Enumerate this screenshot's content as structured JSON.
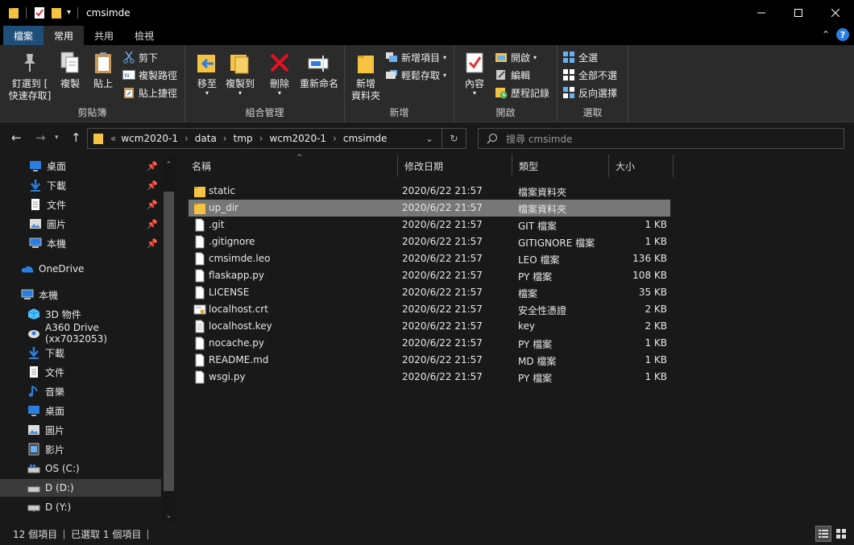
{
  "window": {
    "title": "cmsimde"
  },
  "ribbon_tabs": [
    {
      "label": "檔案"
    },
    {
      "label": "常用"
    },
    {
      "label": "共用"
    },
    {
      "label": "檢視"
    }
  ],
  "clipboard": {
    "pin_label_1": "釘選到 [",
    "pin_label_2": "快速存取]",
    "copy_label": "複製",
    "paste_label": "貼上",
    "cut_label": "剪下",
    "copy_path_label": "複製路徑",
    "paste_shortcut_label": "貼上捷徑",
    "group_label": "剪貼簿"
  },
  "organize": {
    "move_label": "移至",
    "copyto_label": "複製到",
    "delete_label": "刪除",
    "rename_label": "重新命名",
    "group_label": "組合管理"
  },
  "new_group": {
    "new_folder_label_1": "新增",
    "new_folder_label_2": "資料夾",
    "new_item_label": "新增項目",
    "easy_access_label": "輕鬆存取",
    "group_label": "新增"
  },
  "open_group": {
    "properties_label": "內容",
    "open_label": "開啟",
    "edit_label": "編輯",
    "history_label": "歷程記錄",
    "group_label": "開啟"
  },
  "select_group": {
    "select_all_label": "全選",
    "select_none_label": "全部不選",
    "invert_label": "反向選擇",
    "group_label": "選取"
  },
  "address": {
    "overflow": "«",
    "crumbs": [
      "wcm2020-1",
      "data",
      "tmp",
      "wcm2020-1",
      "cmsimde"
    ]
  },
  "search": {
    "placeholder": "搜尋 cmsimde"
  },
  "sidebar": {
    "items": [
      {
        "label": "桌面",
        "icon": "desktop-icon",
        "pinned": true
      },
      {
        "label": "下載",
        "icon": "download-icon",
        "pinned": true
      },
      {
        "label": "文件",
        "icon": "document-icon",
        "pinned": true
      },
      {
        "label": "圖片",
        "icon": "pictures-icon",
        "pinned": true
      },
      {
        "label": "本機",
        "icon": "computer-icon",
        "pinned": true
      },
      {
        "label": "OneDrive",
        "icon": "onedrive-icon"
      },
      {
        "label": "本機",
        "icon": "computer-icon"
      },
      {
        "label": "3D 物件",
        "icon": "3d-objects-icon"
      },
      {
        "label": "A360 Drive (xx7032053)",
        "icon": "a360-drive-icon"
      },
      {
        "label": "下載",
        "icon": "download-icon"
      },
      {
        "label": "文件",
        "icon": "document-icon"
      },
      {
        "label": "音樂",
        "icon": "music-icon"
      },
      {
        "label": "桌面",
        "icon": "desktop-icon"
      },
      {
        "label": "圖片",
        "icon": "pictures-icon"
      },
      {
        "label": "影片",
        "icon": "videos-icon"
      },
      {
        "label": "OS (C:)",
        "icon": "drive-icon"
      },
      {
        "label": "D (D:)",
        "icon": "drive-icon",
        "selected": true
      },
      {
        "label": "D (Y:)",
        "icon": "network-drive-icon"
      }
    ]
  },
  "columns": {
    "name": "名稱",
    "date": "修改日期",
    "type": "類型",
    "size": "大小"
  },
  "files": [
    {
      "name": "static",
      "date": "2020/6/22 21:57",
      "type": "檔案資料夾",
      "size": "",
      "icon": "folder-icon"
    },
    {
      "name": "up_dir",
      "date": "2020/6/22 21:57",
      "type": "檔案資料夾",
      "size": "",
      "icon": "folder-icon",
      "selected": true
    },
    {
      "name": ".git",
      "date": "2020/6/22 21:57",
      "type": "GIT 檔案",
      "size": "1 KB",
      "icon": "file-icon"
    },
    {
      "name": ".gitignore",
      "date": "2020/6/22 21:57",
      "type": "GITIGNORE 檔案",
      "size": "1 KB",
      "icon": "file-icon"
    },
    {
      "name": "cmsimde.leo",
      "date": "2020/6/22 21:57",
      "type": "LEO 檔案",
      "size": "136 KB",
      "icon": "file-icon"
    },
    {
      "name": "flaskapp.py",
      "date": "2020/6/22 21:57",
      "type": "PY 檔案",
      "size": "108 KB",
      "icon": "file-icon"
    },
    {
      "name": "LICENSE",
      "date": "2020/6/22 21:57",
      "type": "檔案",
      "size": "35 KB",
      "icon": "file-icon"
    },
    {
      "name": "localhost.crt",
      "date": "2020/6/22 21:57",
      "type": "安全性憑證",
      "size": "2 KB",
      "icon": "certificate-icon"
    },
    {
      "name": "localhost.key",
      "date": "2020/6/22 21:57",
      "type": "key",
      "size": "2 KB",
      "icon": "key-file-icon"
    },
    {
      "name": "nocache.py",
      "date": "2020/6/22 21:57",
      "type": "PY 檔案",
      "size": "1 KB",
      "icon": "file-icon"
    },
    {
      "name": "README.md",
      "date": "2020/6/22 21:57",
      "type": "MD 檔案",
      "size": "1 KB",
      "icon": "file-icon"
    },
    {
      "name": "wsgi.py",
      "date": "2020/6/22 21:57",
      "type": "PY 檔案",
      "size": "1 KB",
      "icon": "file-icon"
    }
  ],
  "status": {
    "count": "12 個項目",
    "selected": "已選取 1 個項目"
  },
  "colors": {
    "folder": "#f5c242",
    "accent_blue": "#2a7ee0",
    "file_tab": "#1f4e79",
    "selection": "#777777"
  }
}
